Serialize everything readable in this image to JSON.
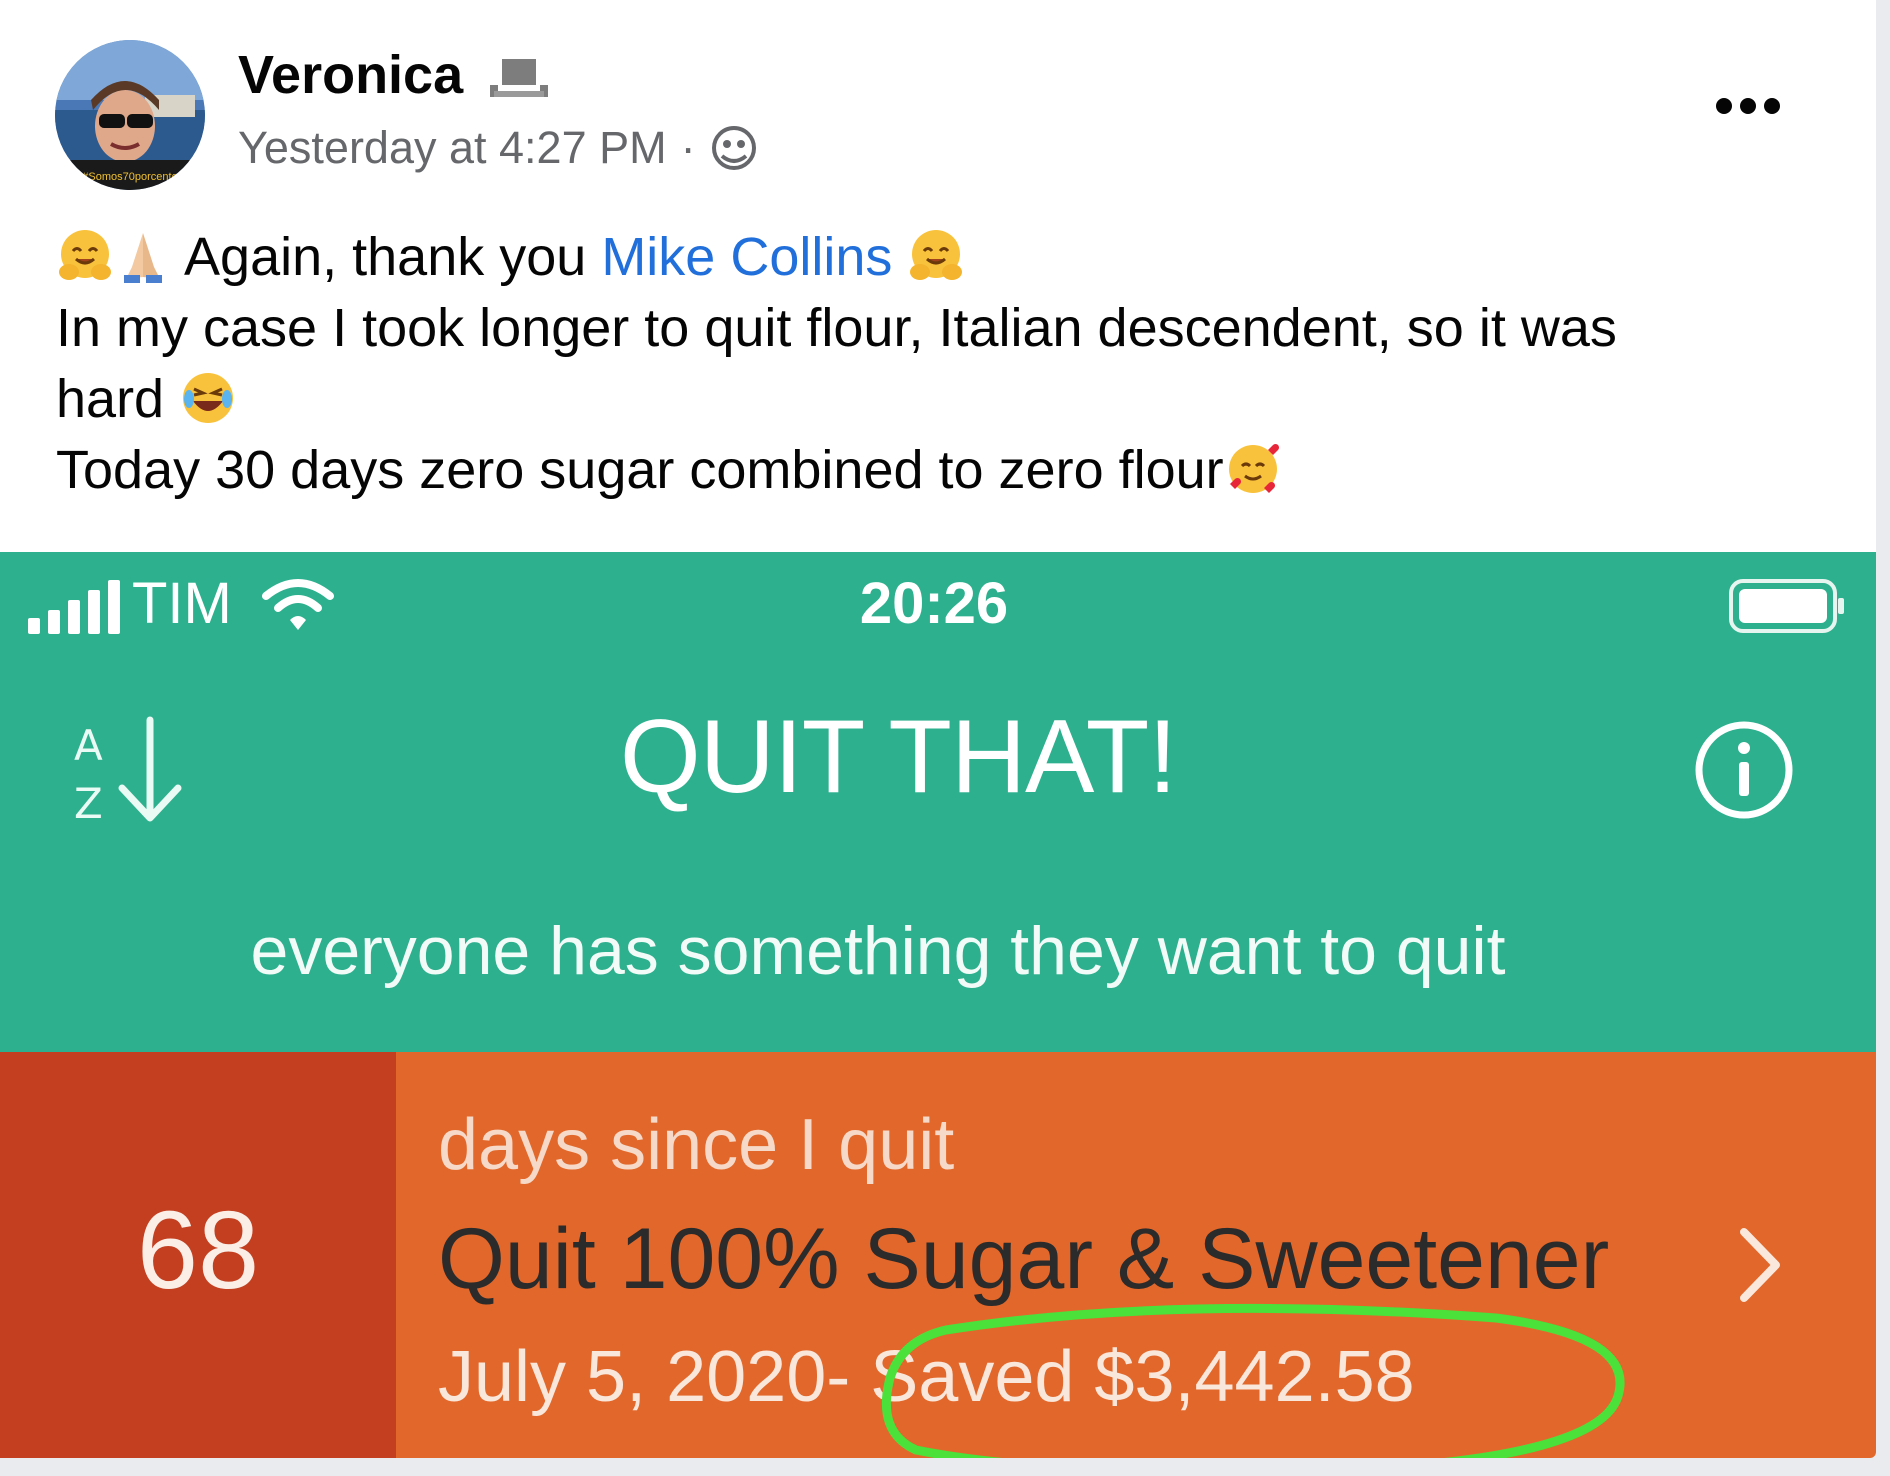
{
  "post": {
    "author": "Veronica",
    "timestamp": "Yesterday at 4:27 PM",
    "separator": "·",
    "avatar_caption": "#Somos70porcento",
    "text": {
      "line1_before": "Again, thank you ",
      "mention": "Mike Collins",
      "line2": "In my case I took longer to quit flour, Italian descendent, so it was",
      "line3": "hard",
      "line4": "Today 30 days zero sugar combined to zero flour"
    },
    "icons": [
      "more-icon",
      "globe-icon",
      "hugging-face-emoji",
      "folded-hands-emoji",
      "laughing-emoji",
      "smiling-hearts-emoji"
    ]
  },
  "app": {
    "status": {
      "carrier": "TIM",
      "time": "20:26"
    },
    "title": "QUIT THAT!",
    "tagline": "everyone has something they want to quit",
    "sort_icon_letters": {
      "top": "A",
      "bottom": "Z"
    },
    "item": {
      "days": "68",
      "days_label": "days since I quit",
      "name": "Quit 100% Sugar & Sweetener",
      "date": "July 5, 2020",
      "saved": "- Saved $3,442.58"
    },
    "colors": {
      "header": "#2db08e",
      "row": "#e2672a",
      "count_box": "#c33f20",
      "highlight_circle": "#4be03a"
    }
  }
}
